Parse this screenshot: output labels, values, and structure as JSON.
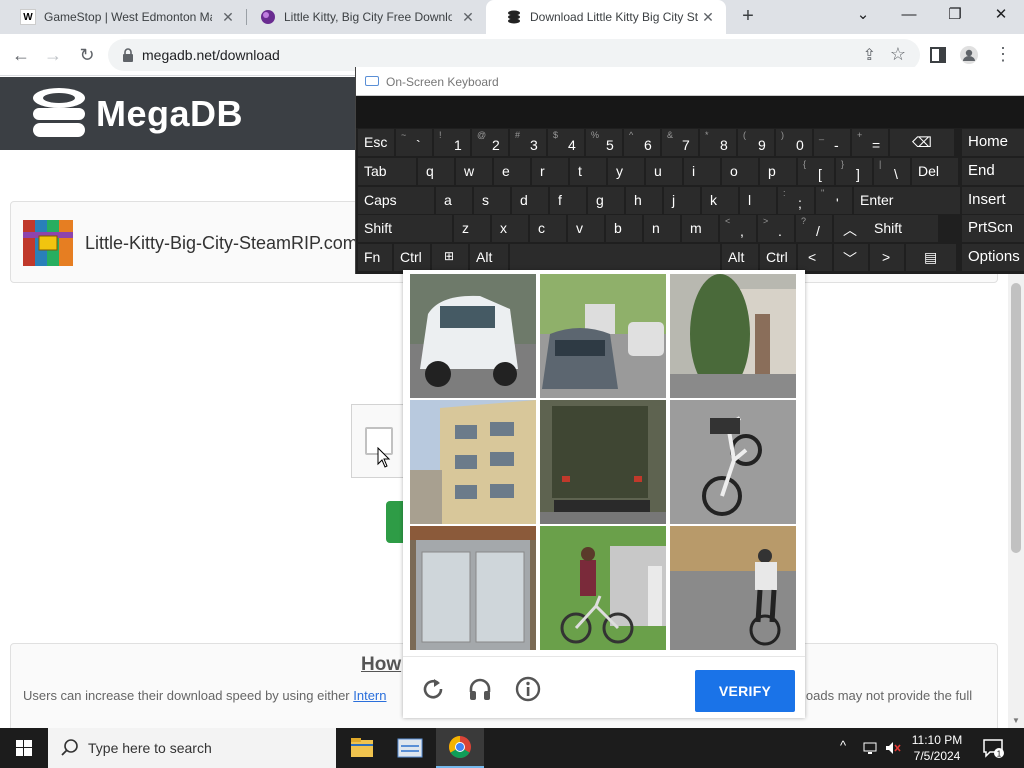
{
  "browser": {
    "tabs": [
      {
        "title": "GameStop | West Edmonton Ma",
        "favicon": "W"
      },
      {
        "title": "Little Kitty, Big City Free Downlo",
        "favicon": ""
      },
      {
        "title": "Download Little Kitty Big City St",
        "favicon": ""
      }
    ],
    "url": "megadb.net/download",
    "colors": {
      "tabstrip": "#dee1e6",
      "active_tab": "#ffffff"
    }
  },
  "osk": {
    "title": "On-Screen Keyboard",
    "row1": [
      {
        "top": "",
        "main": "Esc"
      },
      {
        "top": "~",
        "main": "`"
      },
      {
        "top": "!",
        "main": "1"
      },
      {
        "top": "@",
        "main": "2"
      },
      {
        "top": "#",
        "main": "3"
      },
      {
        "top": "$",
        "main": "4"
      },
      {
        "top": "%",
        "main": "5"
      },
      {
        "top": "^",
        "main": "6"
      },
      {
        "top": "&",
        "main": "7"
      },
      {
        "top": "*",
        "main": "8"
      },
      {
        "top": "(",
        "main": "9"
      },
      {
        "top": ")",
        "main": "0"
      },
      {
        "top": "_",
        "main": "-"
      },
      {
        "top": "+",
        "main": "="
      }
    ],
    "row2": [
      "Tab",
      "q",
      "w",
      "e",
      "r",
      "t",
      "y",
      "u",
      "i",
      "o",
      "p"
    ],
    "row2_extra": [
      {
        "top": "{",
        "main": "["
      },
      {
        "top": "}",
        "main": "]"
      },
      {
        "top": "|",
        "main": "\\"
      }
    ],
    "del": "Del",
    "row3": [
      "Caps",
      "a",
      "s",
      "d",
      "f",
      "g",
      "h",
      "j",
      "k",
      "l"
    ],
    "row3_extra": [
      {
        "top": ":",
        "main": ";"
      },
      {
        "top": "\"",
        "main": "'"
      }
    ],
    "enter": "Enter",
    "row4": [
      "Shift",
      "z",
      "x",
      "c",
      "v",
      "b",
      "n",
      "m"
    ],
    "row4_extra": [
      {
        "top": "<",
        "main": ","
      },
      {
        "top": ">",
        "main": "."
      },
      {
        "top": "?",
        "main": "/"
      }
    ],
    "shift_right": "Shift",
    "row5": {
      "fn": "Fn",
      "ctrl": "Ctrl",
      "alt": "Alt",
      "alt_r": "Alt",
      "ctrl_r": "Ctrl"
    },
    "right_keys": [
      "Home",
      "End",
      "Insert",
      "PrtScn",
      "Options"
    ]
  },
  "site": {
    "brand": "MegaDB",
    "file_name": "Little-Kitty-Big-City-SteamRIP.com",
    "how_title": "How",
    "how_text_before": "Users can increase their download speed by using either ",
    "how_link": "Intern",
    "how_text_after": "loads may not provide the full"
  },
  "captcha": {
    "verify_label": "VERIFY",
    "tiles": [
      "white-car",
      "street-cars",
      "building-tree",
      "apartment-building",
      "truck-rear",
      "bicycle",
      "glass-door",
      "person-with-bicycle",
      "cyclist"
    ]
  },
  "taskbar": {
    "search_placeholder": "Type here to search",
    "time": "11:10 PM",
    "date": "7/5/2024",
    "notifications": "1"
  }
}
